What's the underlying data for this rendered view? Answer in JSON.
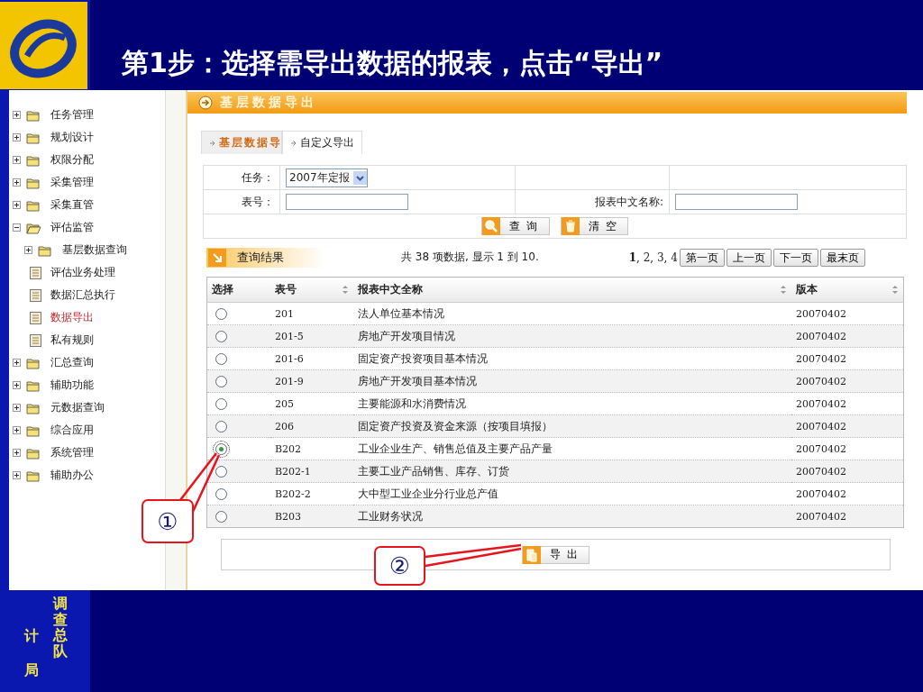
{
  "slide": {
    "title": "第1步：选择需导出数据的报表，点击“导出”",
    "vertical_columns": [
      "计局",
      "调查总队"
    ]
  },
  "nav_tree": [
    {
      "label": "任务管理",
      "kind": "folder",
      "expanded": false,
      "selected": false
    },
    {
      "label": "规划设计",
      "kind": "folder",
      "expanded": false,
      "selected": false
    },
    {
      "label": "权限分配",
      "kind": "folder",
      "expanded": false,
      "selected": false
    },
    {
      "label": "采集管理",
      "kind": "folder",
      "expanded": false,
      "selected": false
    },
    {
      "label": "采集直管",
      "kind": "folder",
      "expanded": false,
      "selected": false
    },
    {
      "label": "评估监管",
      "kind": "folder",
      "expanded": true,
      "selected": false,
      "children": [
        {
          "label": "基层数据查询",
          "kind": "folder",
          "expanded": false,
          "selected": false
        },
        {
          "label": "评估业务处理",
          "kind": "page",
          "selected": false
        },
        {
          "label": "数据汇总执行",
          "kind": "page",
          "selected": false
        },
        {
          "label": "数据导出",
          "kind": "page",
          "selected": true
        },
        {
          "label": "私有规则",
          "kind": "page",
          "selected": false
        }
      ]
    },
    {
      "label": "汇总查询",
      "kind": "folder",
      "expanded": false,
      "selected": false
    },
    {
      "label": "辅助功能",
      "kind": "folder",
      "expanded": false,
      "selected": false
    },
    {
      "label": "元数据查询",
      "kind": "folder",
      "expanded": false,
      "selected": false
    },
    {
      "label": "综合应用",
      "kind": "folder",
      "expanded": false,
      "selected": false
    },
    {
      "label": "系统管理",
      "kind": "folder",
      "expanded": false,
      "selected": false
    },
    {
      "label": "辅助办公",
      "kind": "folder",
      "expanded": false,
      "selected": false
    }
  ],
  "panel": {
    "title": "基层数据导出",
    "tabs": [
      {
        "label": "基层数据导",
        "selected": true
      },
      {
        "label": "自定义导出",
        "selected": false
      }
    ],
    "form": {
      "task_label": "任务：",
      "task_value": "2007年定报",
      "table_no_label": "表号：",
      "name_label": "报表中文名称:",
      "buttons": [
        {
          "label": "查 询",
          "kind": "search"
        },
        {
          "label": "清 空",
          "kind": "clear"
        }
      ]
    },
    "results": {
      "title": "查询结果",
      "summary": "共 38 项数据, 显示 1 到 10.",
      "pages": "**1**, 2, 3, 4",
      "nav_buttons": [
        "第一页",
        "上一页",
        "下一页",
        "最末页"
      ]
    },
    "table": {
      "columns": [
        {
          "label": "选择",
          "sortable": false
        },
        {
          "label": "表号",
          "sortable": true
        },
        {
          "label": "报表中文全称",
          "sortable": true
        },
        {
          "label": "版本",
          "sortable": true
        }
      ],
      "rows": [
        {
          "code": "201",
          "name": "法人单位基本情况",
          "version": "20070402",
          "selected": false
        },
        {
          "code": "201-5",
          "name": "房地产开发项目情况",
          "version": "20070402",
          "selected": false
        },
        {
          "code": "201-6",
          "name": "固定资产投资项目基本情况",
          "version": "20070402",
          "selected": false
        },
        {
          "code": "201-9",
          "name": "房地产开发项目基本情况",
          "version": "20070402",
          "selected": false
        },
        {
          "code": "205",
          "name": "主要能源和水消费情况",
          "version": "20070402",
          "selected": false
        },
        {
          "code": "206",
          "name": "固定资产投资及资金来源（按项目填报）",
          "version": "20070402",
          "selected": false
        },
        {
          "code": "B202",
          "name": "工业企业生产、销售总值及主要产品产量",
          "version": "20070402",
          "selected": true
        },
        {
          "code": "B202-1",
          "name": "主要工业产品销售、库存、订货",
          "version": "20070402",
          "selected": false
        },
        {
          "code": "B202-2",
          "name": "大中型工业企业分行业总产值",
          "version": "20070402",
          "selected": false
        },
        {
          "code": "B203",
          "name": "工业财务状况",
          "version": "20070402",
          "selected": false
        }
      ]
    },
    "export_button": "导 出"
  },
  "callouts": [
    {
      "label": "①"
    },
    {
      "label": "②"
    }
  ]
}
